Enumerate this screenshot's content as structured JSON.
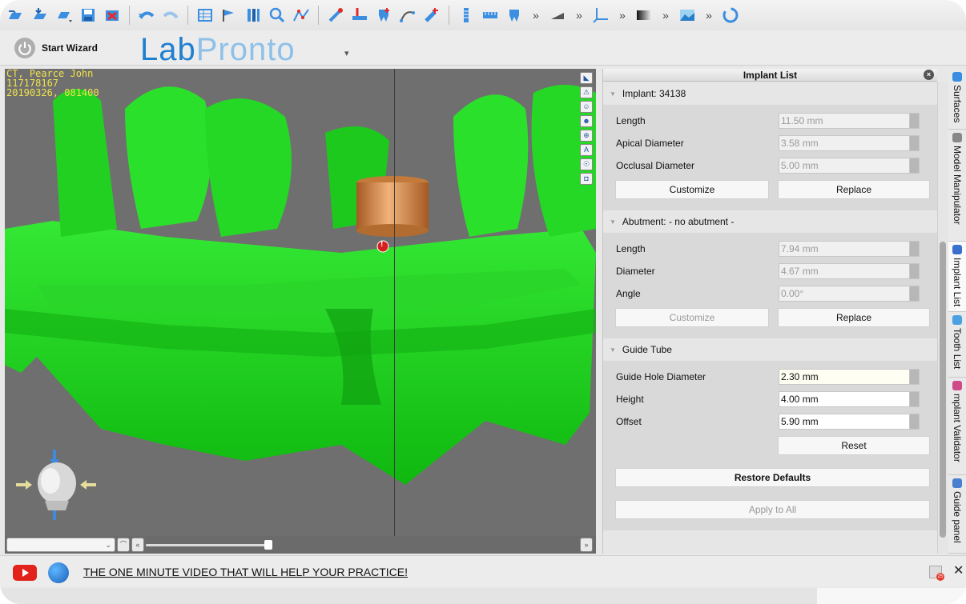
{
  "toolbar": {
    "icons": [
      "open-icon",
      "import-icon",
      "document-menu-icon",
      "save-icon",
      "close-case-icon",
      "undo-icon",
      "redo-icon",
      "grid-icon",
      "flag-icon",
      "columns-icon",
      "zoom-icon",
      "curve-icon",
      "implant-tool-icon",
      "sleeve-icon",
      "tooth-icon",
      "measure-icon",
      "planning-icon",
      "drill-icon",
      "ruler-icon",
      "scanner-icon",
      "tooth-model-icon",
      "surface-icon",
      "axis-icon",
      "gradient-icon",
      "terrain-icon",
      "spinner-icon"
    ],
    "overflow": "»"
  },
  "wizard": {
    "label": "Start Wizard"
  },
  "logo": {
    "lab": "Lab",
    "pronto": "Pronto",
    "caret": "▾"
  },
  "viewport": {
    "patient_name": "CT, Pearce John",
    "patient_id": "117178167",
    "timestamp": "20190326, 081400",
    "warning": "!",
    "tools": [
      "◣",
      "⚠",
      "☺",
      "☻",
      "⊕",
      "A",
      "☉",
      "◘"
    ]
  },
  "panel": {
    "title": "Implant List",
    "implant": {
      "heading": "Implant: 34138",
      "rows": [
        {
          "label": "Length",
          "value": "11.50 mm"
        },
        {
          "label": "Apical Diameter",
          "value": "3.58 mm"
        },
        {
          "label": "Occlusal Diameter",
          "value": "5.00 mm"
        }
      ],
      "customize": "Customize",
      "replace": "Replace"
    },
    "abutment": {
      "heading": "Abutment: - no abutment -",
      "rows": [
        {
          "label": "Length",
          "value": "7.94 mm"
        },
        {
          "label": "Diameter",
          "value": "4.67 mm"
        },
        {
          "label": "Angle",
          "value": "0.00°"
        }
      ],
      "customize": "Customize",
      "replace": "Replace"
    },
    "guide": {
      "heading": "Guide Tube",
      "rows": [
        {
          "label": "Guide Hole Diameter",
          "value": "2.30 mm"
        },
        {
          "label": "Height",
          "value": "4.00 mm"
        },
        {
          "label": "Offset",
          "value": "5.90 mm"
        }
      ],
      "reset": "Reset",
      "restore": "Restore Defaults",
      "apply_all": "Apply to All"
    }
  },
  "sidetabs": [
    {
      "label": "Surfaces",
      "color": "#3a8de0"
    },
    {
      "label": "Model Manipulator",
      "color": "#888888"
    },
    {
      "label": "Implant List",
      "color": "#3a6fd0"
    },
    {
      "label": "Tooth List",
      "color": "#4aa0e0"
    },
    {
      "label": "mplant Validator",
      "color": "#d04a8a"
    },
    {
      "label": "Guide panel",
      "color": "#4a7fd0"
    }
  ],
  "footer": {
    "promo": "THE ONE MINUTE VIDEO THAT WILL HELP YOUR PRACTICE!",
    "badge": "25",
    "close": "✕"
  },
  "colors": {
    "model_green": "#1fd61f",
    "implant_copper": "#d98d4a",
    "accent_blue": "#1f7fd0"
  }
}
